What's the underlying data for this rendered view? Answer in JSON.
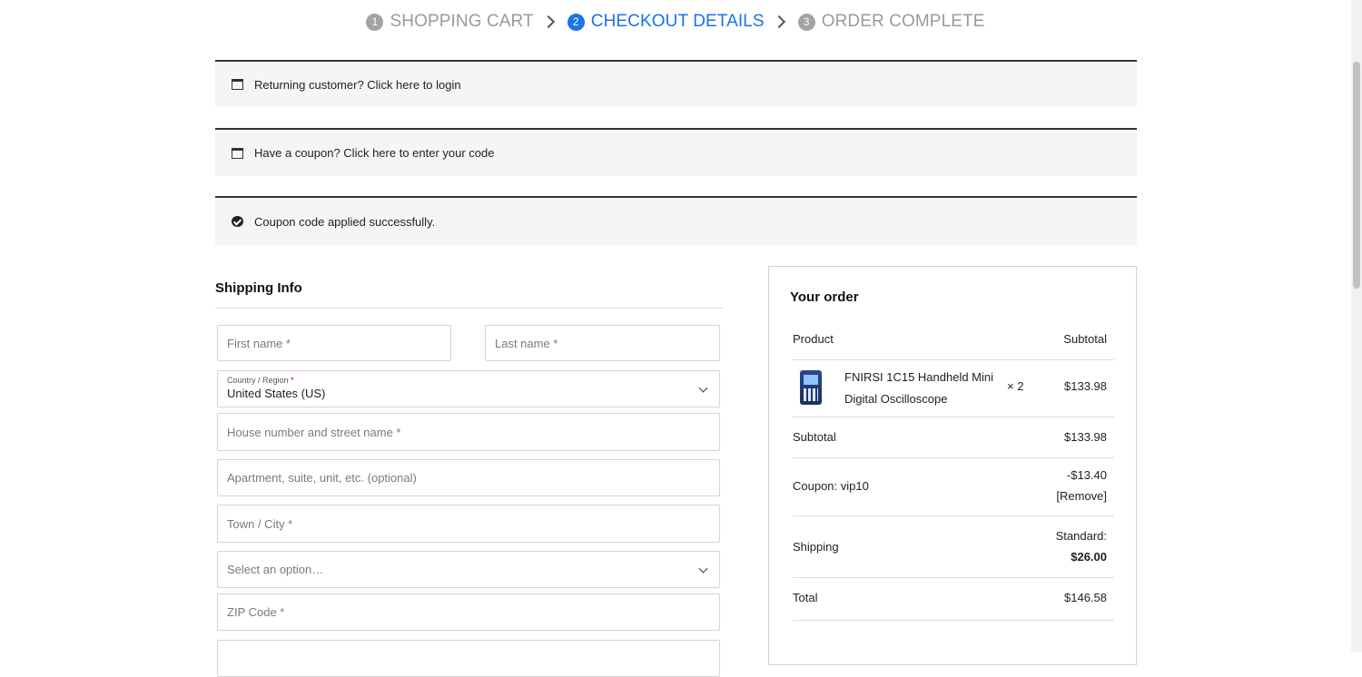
{
  "steps": [
    {
      "num": "1",
      "label": "SHOPPING CART"
    },
    {
      "num": "2",
      "label": "CHECKOUT DETAILS"
    },
    {
      "num": "3",
      "label": "ORDER COMPLETE"
    }
  ],
  "notices": {
    "login": "Returning customer? Click here to login",
    "coupon": "Have a coupon? Click here to enter your code",
    "success": "Coupon code applied successfully."
  },
  "shipping": {
    "title": "Shipping Info",
    "first_name": "First name *",
    "last_name": "Last name *",
    "country_label": "Country / Region",
    "country_req": "*",
    "country_value": "United States (US)",
    "street": "House number and street name *",
    "apartment": "Apartment, suite, unit, etc. (optional)",
    "city": "Town / City *",
    "state": "Select an option…",
    "zip": "ZIP Code *"
  },
  "order": {
    "title": "Your order",
    "col_product": "Product",
    "col_subtotal": "Subtotal",
    "item": {
      "name_line1": "FNIRSI 1C15 Handheld Mini",
      "name_line2": "Digital Oscilloscope",
      "qty": "× 2",
      "price": "$133.98"
    },
    "subtotal_label": "Subtotal",
    "subtotal_value": "$133.98",
    "coupon_label": "Coupon: vip10",
    "coupon_value": "-$13.40",
    "coupon_remove": "[Remove]",
    "shipping_label": "Shipping",
    "shipping_method": "Standard:",
    "shipping_value": "$26.00",
    "total_label": "Total",
    "total_value": "$146.58"
  },
  "colors": {
    "accent": "#1a73e8",
    "step_inactive": "#9a9a9a"
  }
}
